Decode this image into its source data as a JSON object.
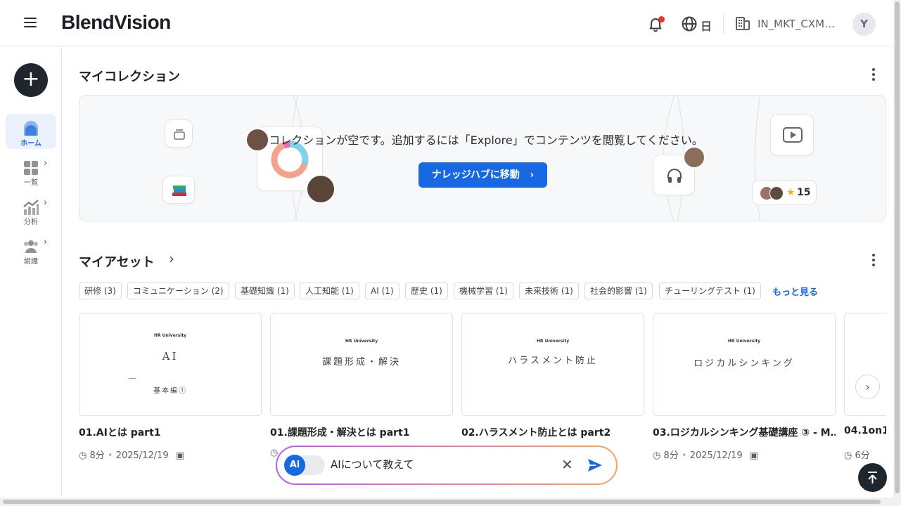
{
  "header": {
    "logo": "BlendVision",
    "language": "日",
    "org_name": "IN_MKT_CXM…",
    "avatar_initial": "Y"
  },
  "sidebar": {
    "items": [
      {
        "label": "ホーム",
        "icon": "home-icon",
        "active": true
      },
      {
        "label": "一覧",
        "icon": "grid-icon",
        "active": false
      },
      {
        "label": "分析",
        "icon": "analytics-icon",
        "active": false
      },
      {
        "label": "組織",
        "icon": "people-icon",
        "active": false
      }
    ]
  },
  "collection": {
    "title": "マイコレクション",
    "empty_message": "コレクションが空です。追加するには「Explore」でコンテンツを閲覧してください。",
    "cta_label": "ナレッジハブに移動",
    "rating_count": "15"
  },
  "assets": {
    "title": "マイアセット",
    "more_label": "もっと見る",
    "tags": [
      "研修 (3)",
      "コミュニケーション (2)",
      "基礎知識 (1)",
      "人工知能 (1)",
      "AI (1)",
      "歴史 (1)",
      "機械学習 (1)",
      "未来技術 (1)",
      "社会的影響 (1)",
      "チューリングテスト (1)"
    ],
    "cards": [
      {
        "thumb_brand": "HR University",
        "thumb_title": "AI",
        "thumb_sub": "基本編①",
        "title": "01.AIとは part1",
        "duration": "8分",
        "date": "2025/12/19"
      },
      {
        "thumb_brand": "HR University",
        "thumb_title": "課題形成・解決",
        "thumb_sub": "",
        "title": "01.課題形成・解決とは part1",
        "duration": "",
        "date": ""
      },
      {
        "thumb_brand": "HR University",
        "thumb_title": "ハラスメント防止",
        "thumb_sub": "",
        "title": "02.ハラスメント防止とは part2",
        "duration": "",
        "date": ""
      },
      {
        "thumb_brand": "HR University",
        "thumb_title": "ロジカルシンキング",
        "thumb_sub": "",
        "title": "03.ロジカルシンキング基礎講座 ③ - M…",
        "duration": "8分",
        "date": "2025/12/19"
      },
      {
        "thumb_brand": "",
        "thumb_title": "",
        "thumb_sub": "",
        "title": "04.1on1(",
        "duration": "6分",
        "date": ""
      }
    ]
  },
  "ai_assistant": {
    "toggle_label": "Ai",
    "input_value": "AIについて教えて"
  },
  "colors": {
    "brand_blue": "#1668e3",
    "dark": "#1f262e",
    "notification_dot": "#ea3323"
  }
}
